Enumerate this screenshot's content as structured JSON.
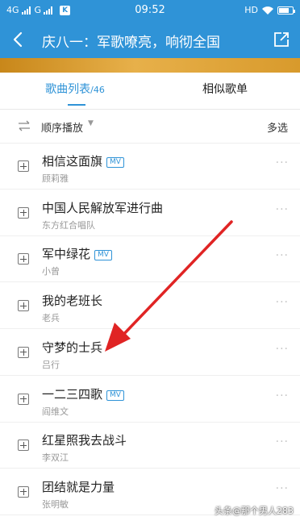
{
  "status_bar": {
    "network_1": "4G",
    "network_2": "G",
    "time": "09:52",
    "hd": "HD"
  },
  "header": {
    "title": "庆八一：军歌嘹亮，响彻全国"
  },
  "tabs": {
    "songs_label": "歌曲列表",
    "songs_count": "/46",
    "similar_label": "相似歌单"
  },
  "toolbar": {
    "order_label": "顺序播放",
    "multi_select": "多选"
  },
  "songs": [
    {
      "title": "相信这面旗",
      "artist": "顾莉雅",
      "mv": "MV"
    },
    {
      "title": "中国人民解放军进行曲",
      "artist": "东方红合唱队",
      "mv": null
    },
    {
      "title": "军中绿花",
      "artist": "小曾",
      "mv": "MV"
    },
    {
      "title": "我的老班长",
      "artist": "老兵",
      "mv": null
    },
    {
      "title": "守梦的士兵",
      "artist": "吕行",
      "mv": null
    },
    {
      "title": "一二三四歌",
      "artist": "阎维文",
      "mv": "MV"
    },
    {
      "title": "红星照我去战斗",
      "artist": "李双江",
      "mv": null
    },
    {
      "title": "团结就是力量",
      "artist": "张明敏",
      "mv": null
    }
  ],
  "more_glyph": "···",
  "watermark": "头条@那个男人283",
  "colors": {
    "accent": "#2f93d7",
    "banner": "#d89a2c",
    "arrow": "#e02424"
  }
}
